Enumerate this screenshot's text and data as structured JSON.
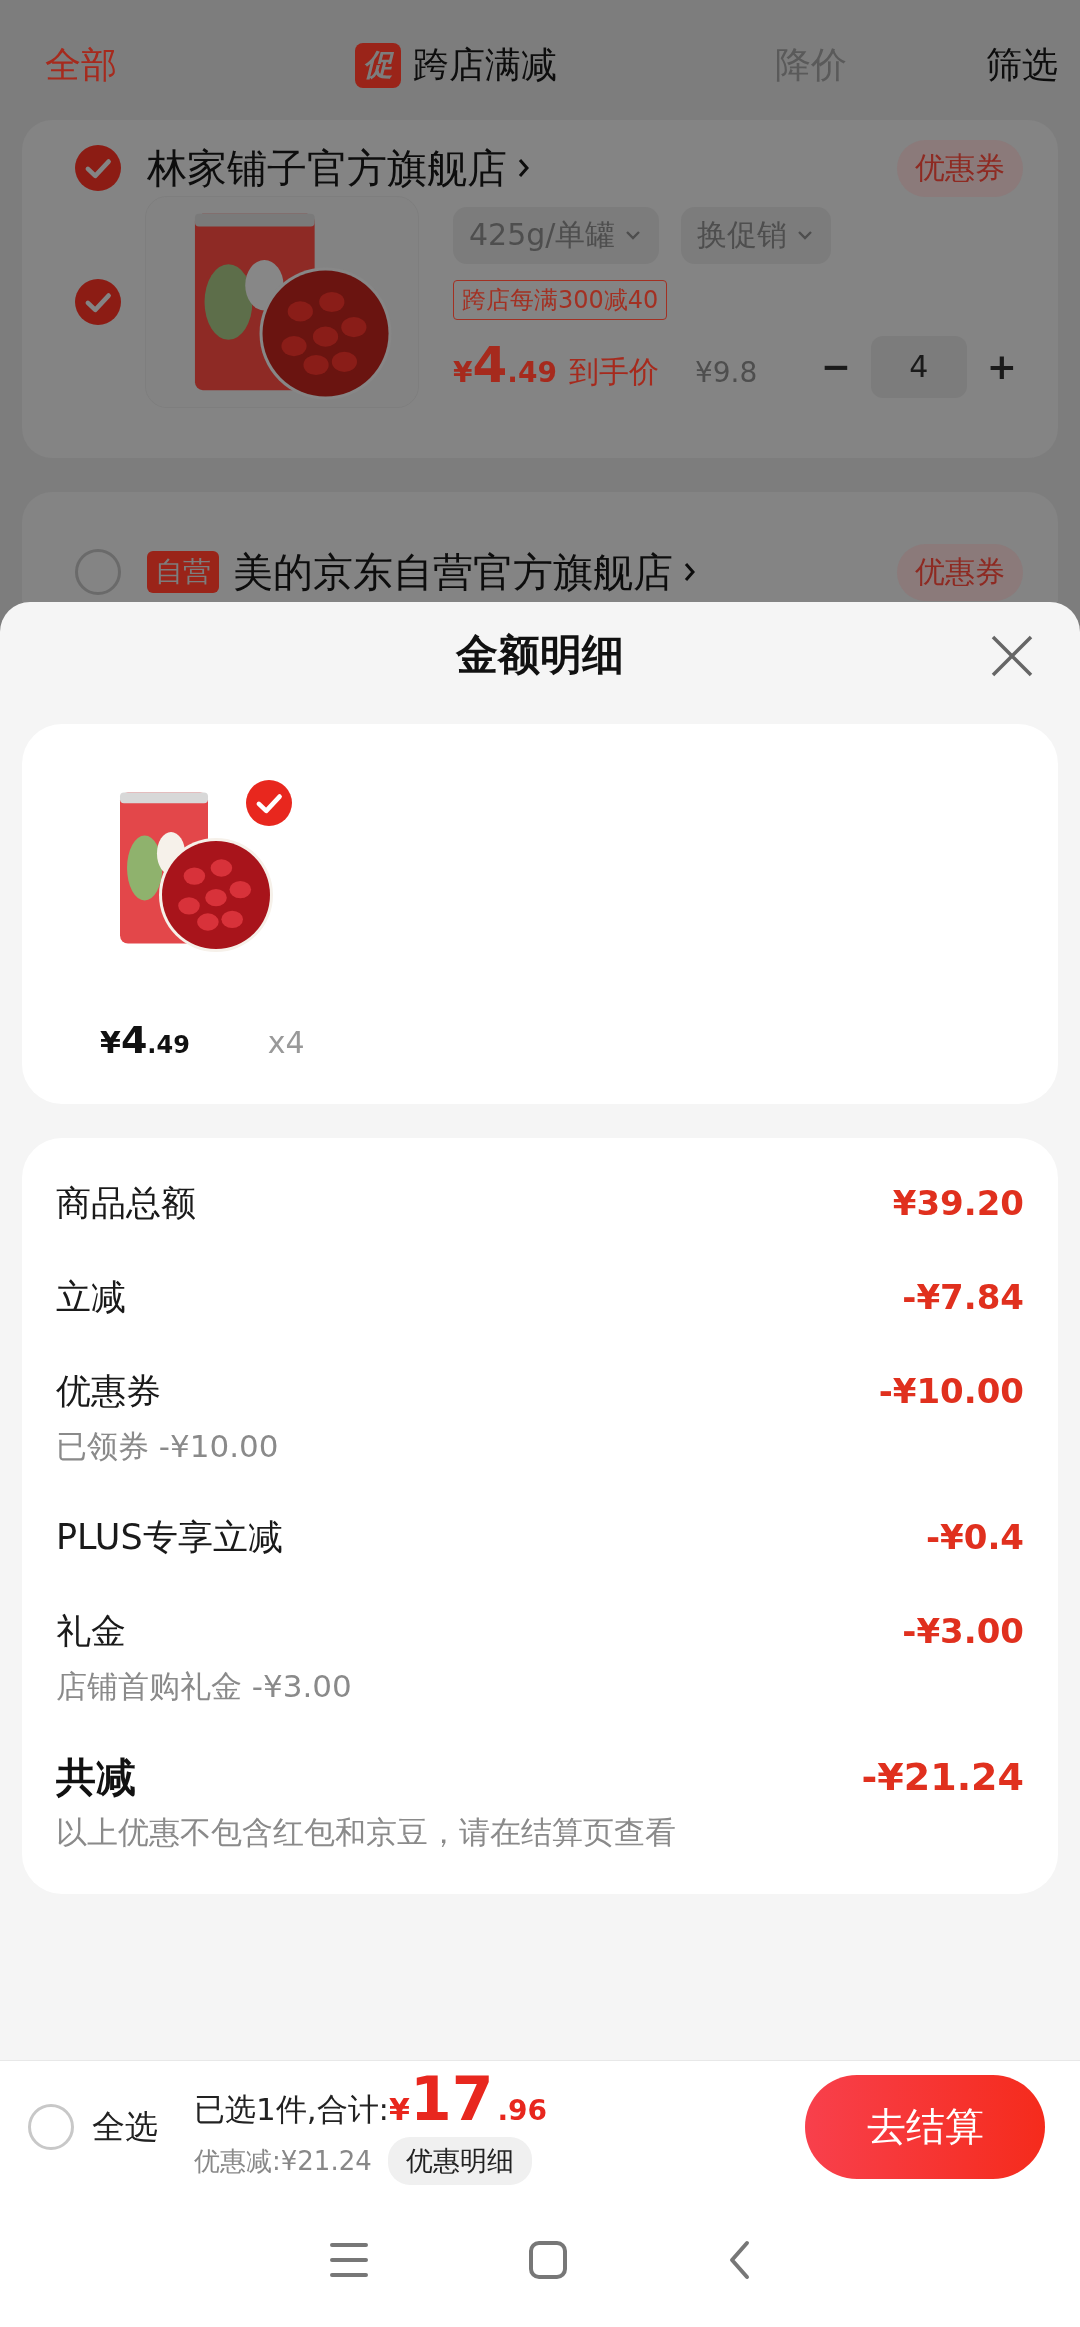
{
  "tabs": [
    {
      "label": "全部",
      "selected": true,
      "disabled": false
    },
    {
      "label": "跨店满减",
      "badge": "促",
      "selected": false,
      "disabled": false
    },
    {
      "label": "降价",
      "selected": false,
      "disabled": true
    }
  ],
  "filter": {
    "label": "筛选"
  },
  "stores": [
    {
      "name": "林家铺子官方旗舰店",
      "checked": true,
      "coupon": "优惠券",
      "items": [
        {
          "checked": true,
          "spec": "425g/单罐",
          "promo_switch": "换促销",
          "promo_tag": "跨店每满300减40",
          "currency": "¥",
          "price_int": "4",
          "price_dec": ".49",
          "price_note": "到手价",
          "original_price": "¥9.8",
          "minus": "−",
          "qty": "4",
          "plus": "+"
        }
      ]
    },
    {
      "name": "美的京东自营官方旗舰店",
      "badge": "自营",
      "checked": false,
      "coupon": "优惠券"
    }
  ],
  "sheet": {
    "title": "金额明细",
    "products": [
      {
        "kind": "picture",
        "checked": true,
        "currency": "¥",
        "price_int": "4",
        "price_dec": ".49",
        "qty": "x4"
      }
    ],
    "lines": [
      {
        "label": "商品总额",
        "amount": "¥39.20"
      },
      {
        "label": "立减",
        "amount": "-¥7.84"
      },
      {
        "label": "优惠券",
        "amount": "-¥10.00",
        "note": "已领券 -¥10.00"
      },
      {
        "label": "PLUS专享立减",
        "amount": "-¥0.4"
      },
      {
        "label": "礼金",
        "amount": "-¥3.00",
        "note": "店铺首购礼金 -¥3.00"
      }
    ],
    "total": {
      "label": "共减",
      "amount": "-¥21.24",
      "note": "以上优惠不包含红包和京豆，请在结算页查看"
    }
  },
  "bottom_bar": {
    "select_all": {
      "label": "全选",
      "checked": false
    },
    "summary": "已选1件,合计:",
    "currency": "¥",
    "total_int": "17",
    "total_dec": ".96",
    "discount": "优惠减:¥21.24",
    "detail_button": "优惠明细",
    "checkout_button": "去结算"
  }
}
